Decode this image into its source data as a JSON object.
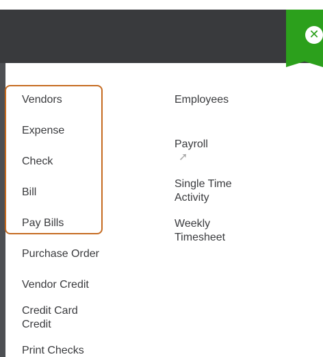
{
  "close": {
    "icon": "close-icon"
  },
  "vendors": {
    "heading": "Vendors",
    "items": [
      "Expense",
      "Check",
      "Bill",
      "Pay Bills",
      "Purchase Order",
      "Vendor Credit",
      "Credit Card\nCredit",
      "Print Checks"
    ]
  },
  "employees": {
    "heading": "Employees",
    "items": [
      "Payroll",
      "Single Time\nActivity",
      "Weekly\nTimesheet"
    ],
    "payroll_icon": "arrow-up-right-icon"
  },
  "colors": {
    "topbar": "#393a3d",
    "accent_green": "#2ca01c",
    "highlight_orange": "#c56a1f",
    "text": "#393a3d"
  }
}
